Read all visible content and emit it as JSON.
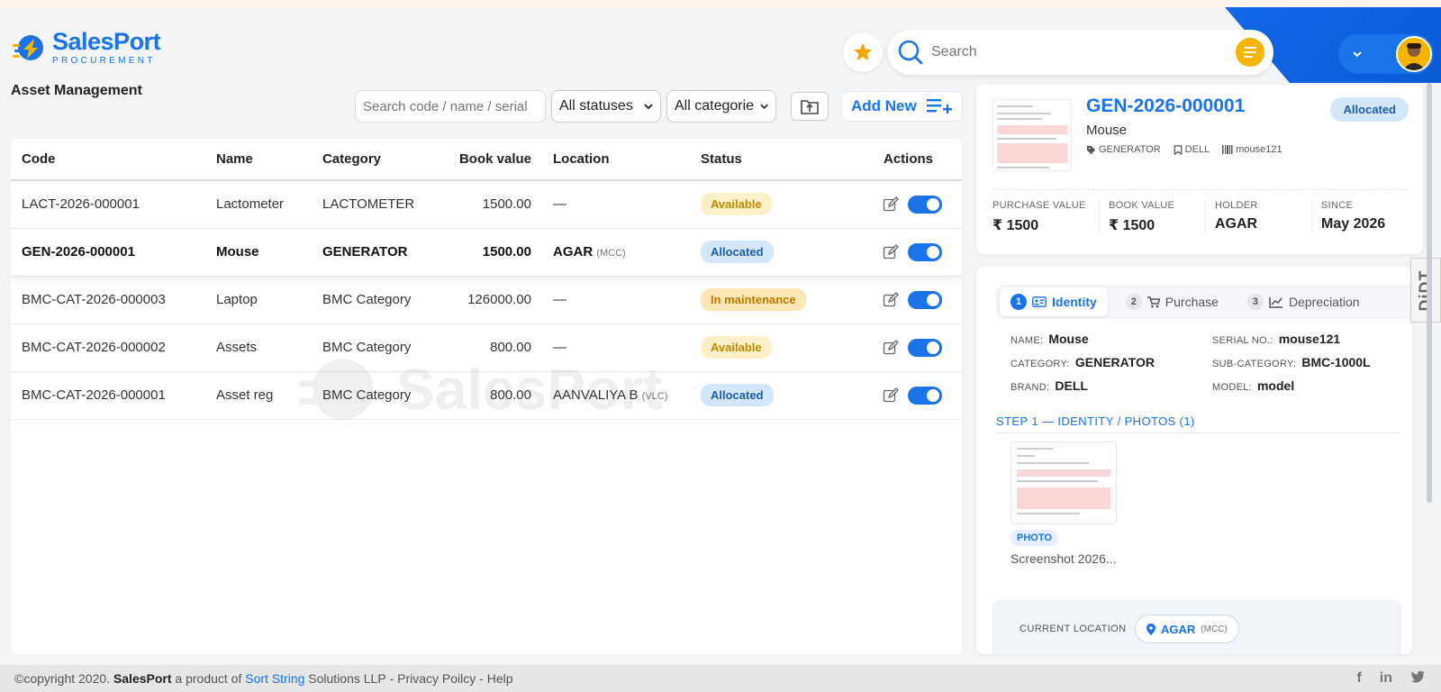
{
  "app": {
    "brand": "SalesPort",
    "brand_sub": "PROCUREMENT",
    "page_title": "Asset Management"
  },
  "header": {
    "search_placeholder": "Search",
    "star_icon": "star-icon",
    "menu_icon": "hamburger-icon"
  },
  "toolbar": {
    "search_placeholder": "Search code / name / serial",
    "status_filter": "All statuses",
    "category_filter": "All categories",
    "add_new_label": "Add New"
  },
  "table": {
    "columns": [
      "Code",
      "Name",
      "Category",
      "Book value",
      "Location",
      "Status",
      "Actions"
    ],
    "rows": [
      {
        "code": "LACT-2026-000001",
        "name": "Lactometer",
        "category": "LACTOMETER",
        "book_value": "1500.00",
        "location": "—",
        "location_sub": "",
        "status": "Available",
        "status_type": "available",
        "enabled": true
      },
      {
        "code": "GEN-2026-000001",
        "name": "Mouse",
        "category": "GENERATOR",
        "book_value": "1500.00",
        "location": "AGAR",
        "location_sub": "(MCC)",
        "status": "Allocated",
        "status_type": "allocated",
        "enabled": true,
        "selected": true
      },
      {
        "code": "BMC-CAT-2026-000003",
        "name": "Laptop",
        "category": "BMC Category",
        "book_value": "126000.00",
        "location": "—",
        "location_sub": "",
        "status": "In maintenance",
        "status_type": "maintenance",
        "enabled": true
      },
      {
        "code": "BMC-CAT-2026-000002",
        "name": "Assets",
        "category": "BMC Category",
        "book_value": "800.00",
        "location": "—",
        "location_sub": "",
        "status": "Available",
        "status_type": "available",
        "enabled": true
      },
      {
        "code": "BMC-CAT-2026-000001",
        "name": "Asset reg",
        "category": "BMC Category",
        "book_value": "800.00",
        "location": "AANVALIYA B",
        "location_sub": "(VLC)",
        "status": "Allocated",
        "status_type": "allocated",
        "enabled": true
      }
    ]
  },
  "summary": {
    "code": "GEN-2026-000001",
    "name": "Mouse",
    "status": "Allocated",
    "tag_category": "GENERATOR",
    "tag_brand": "DELL",
    "tag_serial": "mouse121",
    "metrics": [
      {
        "label": "PURCHASE VALUE",
        "value": "₹ 1500"
      },
      {
        "label": "BOOK VALUE",
        "value": "₹ 1500"
      },
      {
        "label": "HOLDER",
        "value": "AGAR"
      },
      {
        "label": "SINCE",
        "value": "May 2026"
      }
    ]
  },
  "detail": {
    "tabs": [
      {
        "num": "1",
        "label": "Identity",
        "active": true
      },
      {
        "num": "2",
        "label": "Purchase",
        "active": false
      },
      {
        "num": "3",
        "label": "Depreciation",
        "active": false
      }
    ],
    "fields": [
      {
        "label": "NAME:",
        "value": "Mouse"
      },
      {
        "label": "SERIAL NO.:",
        "value": "mouse121"
      },
      {
        "label": "CATEGORY:",
        "value": "GENERATOR"
      },
      {
        "label": "SUB-CATEGORY:",
        "value": "BMC-1000L"
      },
      {
        "label": "BRAND:",
        "value": "DELL"
      },
      {
        "label": "MODEL:",
        "value": "model"
      }
    ],
    "step_title": "STEP 1 — IDENTITY / PHOTOS (1)",
    "photo_badge": "PHOTO",
    "photo_name": "Screenshot 2026...",
    "location_label": "CURRENT LOCATION",
    "location_value": "AGAR",
    "location_sub": "(MCC)"
  },
  "side_tab": "DiDT",
  "footer": {
    "copyright": "©copyright 2020.",
    "brand": "SalesPort",
    "product_of": "a product of",
    "company_link": "Sort String",
    "company_rest": "Solutions LLP",
    "sep1": "-",
    "privacy": "Privacy Poilcy",
    "sep2": "-",
    "help": "Help",
    "social": [
      "f",
      "in"
    ]
  },
  "colors": {
    "primary": "#1a73e8",
    "accent": "#f5b400",
    "available_bg": "#fdf0c8",
    "allocated_bg": "#d4e6fa",
    "maintenance_bg": "#fde7b4"
  }
}
